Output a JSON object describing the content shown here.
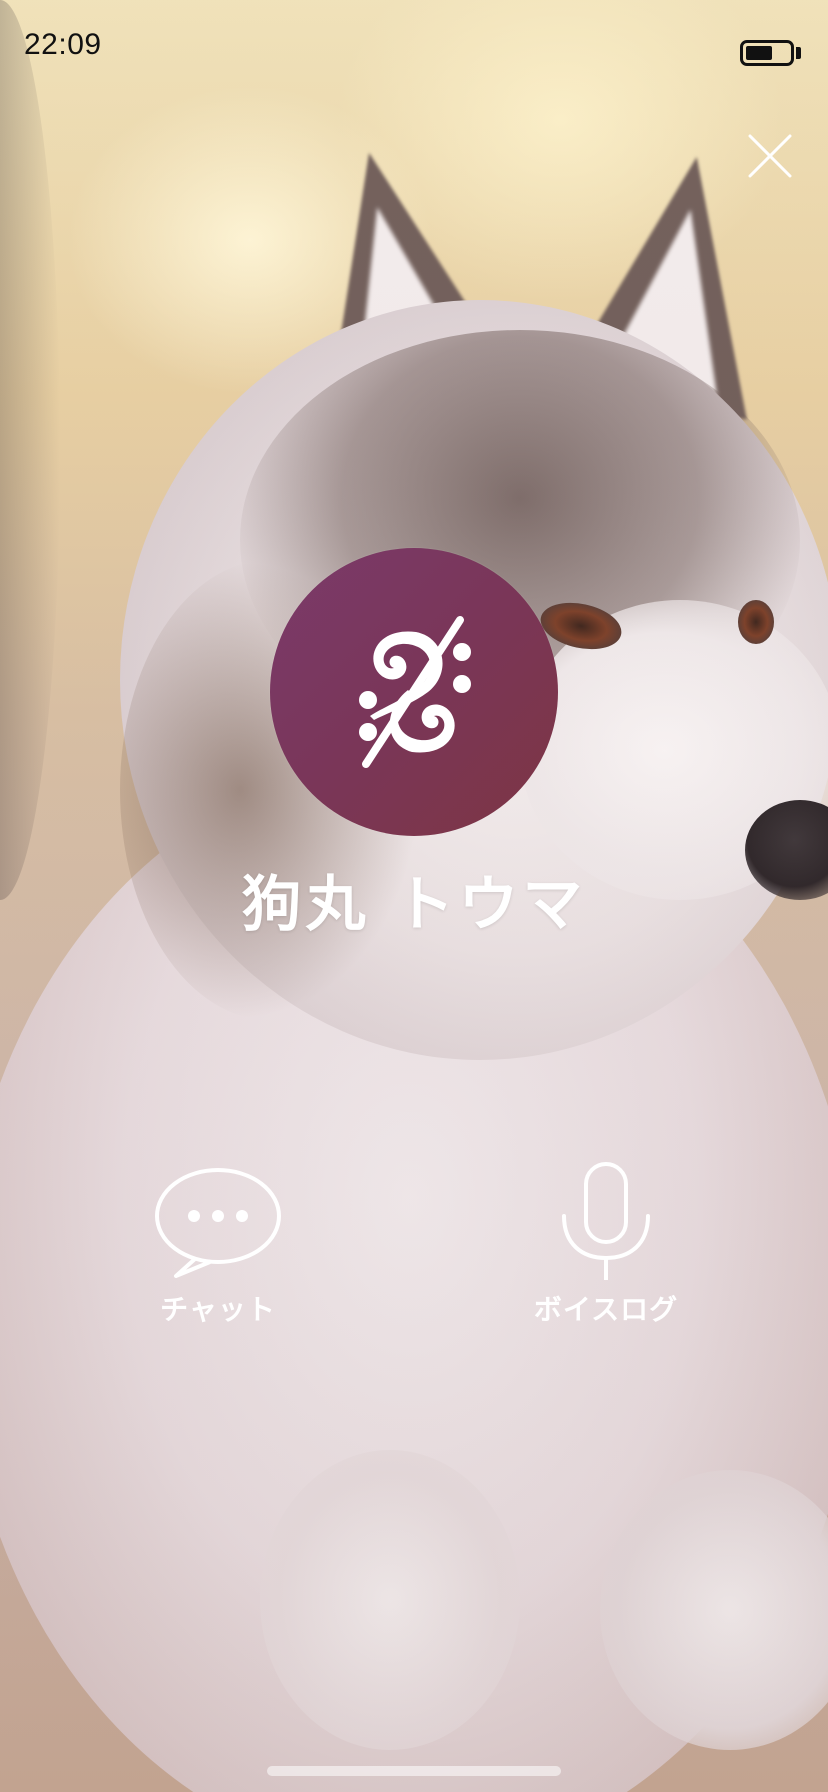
{
  "status_bar": {
    "time": "22:09",
    "battery_level": 0.62,
    "battery_icon": "battery-icon"
  },
  "background": {
    "description_icon": "husky-photo",
    "accent": "#7a3658"
  },
  "close": {
    "icon": "close-icon"
  },
  "profile": {
    "avatar_icon": "bass-clef-logo-icon",
    "avatar_color_top": "#7b3a6b",
    "avatar_color_bottom": "#7d3543",
    "name": "狗丸 トウマ"
  },
  "actions": [
    {
      "label": "チャット",
      "icon": "chat-bubble-icon"
    },
    {
      "label": "ボイスログ",
      "icon": "microphone-icon"
    }
  ]
}
